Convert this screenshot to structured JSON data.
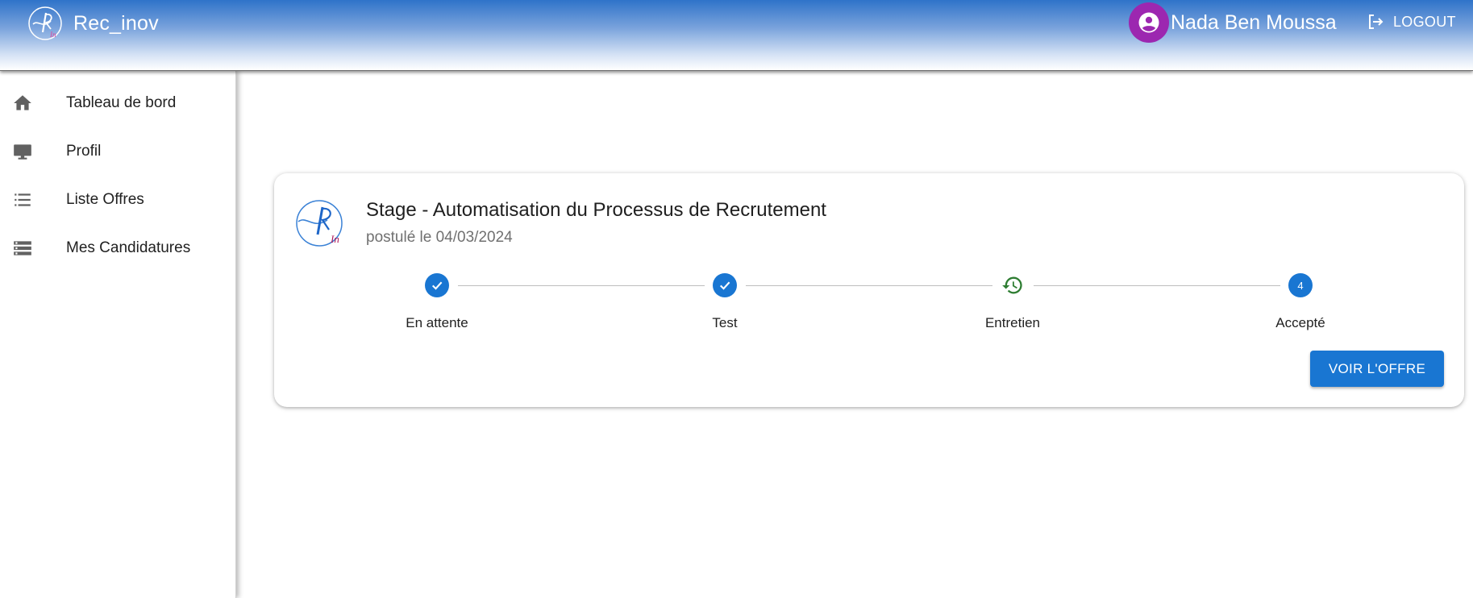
{
  "app": {
    "title": "Rec_inov"
  },
  "user": {
    "name": "Nada Ben Moussa",
    "avatar_icon": "account-circle-icon",
    "avatar_color": "#9c27b0"
  },
  "header": {
    "logout_label": "LOGOUT",
    "logout_icon": "logout-icon"
  },
  "sidebar": {
    "items": [
      {
        "label": "Tableau de bord",
        "icon": "home-icon"
      },
      {
        "label": "Profil",
        "icon": "monitor-icon"
      },
      {
        "label": "Liste Offres",
        "icon": "list-icon"
      },
      {
        "label": "Mes Candidatures",
        "icon": "storage-icon"
      }
    ]
  },
  "application": {
    "title": "Stage - Automatisation du Processus de Recrutement",
    "applied_date": "postulé le 04/03/2024",
    "steps": [
      {
        "label": "En attente",
        "status": "completed",
        "icon": "check-icon"
      },
      {
        "label": "Test",
        "status": "completed",
        "icon": "check-icon"
      },
      {
        "label": "Entretien",
        "status": "in-progress",
        "icon": "history-icon"
      },
      {
        "label": "Accepté",
        "status": "pending",
        "number": "4"
      }
    ],
    "button_label": "VOIR L'OFFRE"
  },
  "colors": {
    "primary": "#1976d2",
    "in_progress": "#2e7d32",
    "avatar": "#9c27b0"
  }
}
